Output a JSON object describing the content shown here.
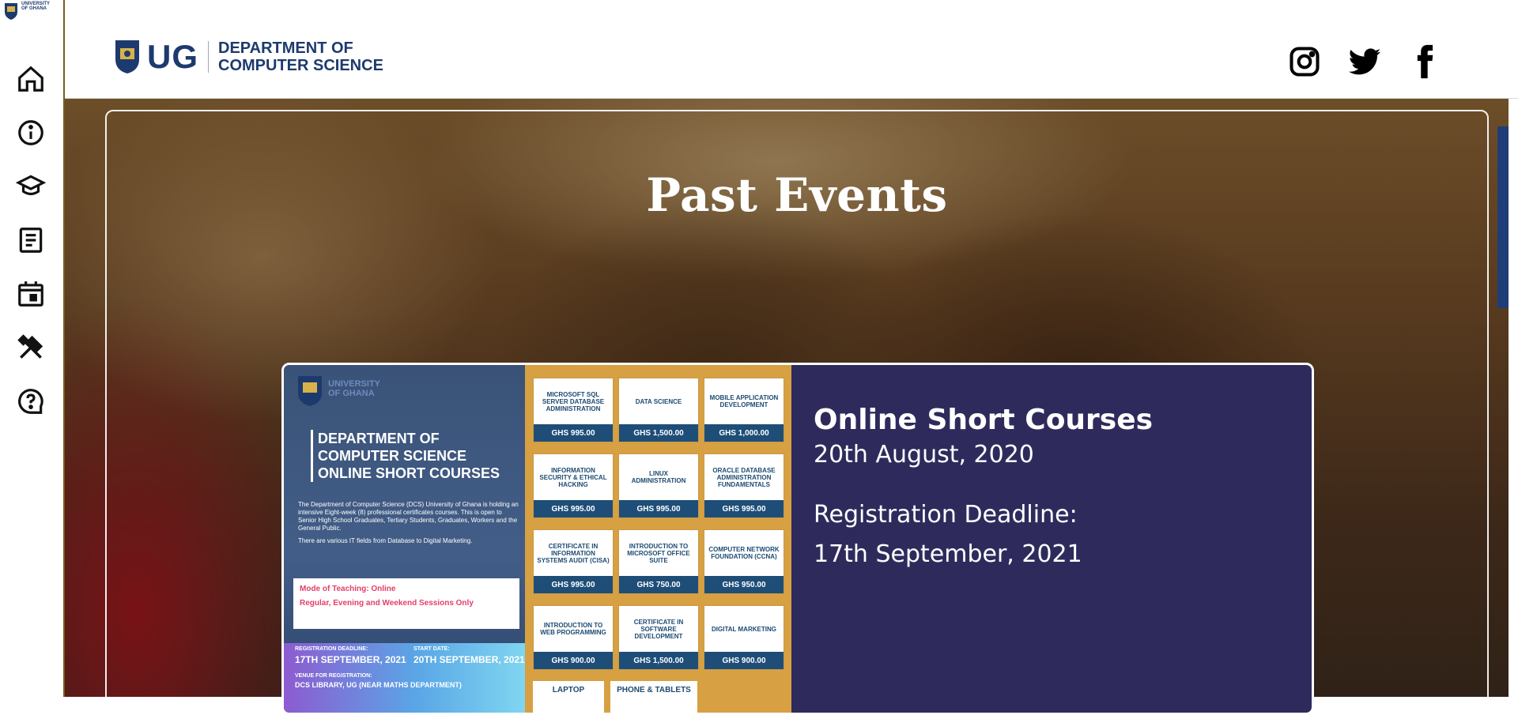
{
  "sidebar": {
    "logo_text": [
      "UNIVERSITY",
      "OF GHANA"
    ],
    "icons": [
      "home-icon",
      "info-icon",
      "graduation-cap-icon",
      "article-icon",
      "calendar-icon",
      "tools-icon",
      "help-icon"
    ]
  },
  "header": {
    "brand_abbr": "UG",
    "brand_line1": "DEPARTMENT OF",
    "brand_line2": "COMPUTER SCIENCE",
    "social": [
      "instagram-icon",
      "twitter-icon",
      "facebook-icon"
    ]
  },
  "hero": {
    "title": "Past Events"
  },
  "event": {
    "title": "Online Short Courses",
    "date": "20th August, 2020",
    "deadline_label": "Registration Deadline:",
    "deadline": "17th September, 2021",
    "flyer": {
      "uni_line1": "UNIVERSITY",
      "uni_line2": "OF GHANA",
      "heading1": "DEPARTMENT OF",
      "heading2": "COMPUTER SCIENCE",
      "heading3": "ONLINE SHORT COURSES",
      "intro1": "The Department of Computer Science (DCS) University of Ghana is holding an intensive Eight-week (8) professional certificates courses. This is open to Senior High School Graduates, Tertiary Students, Graduates, Workers and the General Public.",
      "intro2": "There are various IT fields from Database to Digital Marketing.",
      "mode": "Mode of Teaching: Online",
      "sessions": "Regular, Evening and Weekend Sessions Only",
      "reg_label": "REGISTRATION DEADLINE:",
      "reg_value": "17TH SEPTEMBER, 2021",
      "start_label": "START DATE:",
      "start_value": "20TH SEPTEMBER, 2021",
      "venue_label": "VENUE FOR REGISTRATION:",
      "venue_value": "DCS LIBRARY, UG (NEAR MATHS DEPARTMENT)",
      "courses": [
        {
          "name": "MICROSOFT SQL SERVER DATABASE ADMINISTRATION",
          "price": "GHS 995.00"
        },
        {
          "name": "DATA SCIENCE",
          "price": "GHS 1,500.00"
        },
        {
          "name": "MOBILE APPLICATION DEVELOPMENT",
          "price": "GHS 1,000.00"
        },
        {
          "name": "INFORMATION SECURITY & ETHICAL HACKING",
          "price": "GHS 995.00"
        },
        {
          "name": "LINUX ADMINISTRATION",
          "price": "GHS 995.00"
        },
        {
          "name": "ORACLE DATABASE ADMINISTRATION FUNDAMENTALS",
          "price": "GHS 995.00"
        },
        {
          "name": "CERTIFICATE IN INFORMATION SYSTEMS AUDIT (CISA)",
          "price": "GHS 995.00"
        },
        {
          "name": "INTRODUCTION TO MICROSOFT OFFICE SUITE",
          "price": "GHS 750.00"
        },
        {
          "name": "COMPUTER NETWORK FOUNDATION (CCNA)",
          "price": "GHS 950.00"
        },
        {
          "name": "INTRODUCTION TO WEB PROGRAMMING",
          "price": "GHS 900.00"
        },
        {
          "name": "CERTIFICATE IN SOFTWARE DEVELOPMENT",
          "price": "GHS 1,500.00"
        },
        {
          "name": "DIGITAL MARKETING",
          "price": "GHS 900.00"
        }
      ],
      "extra1": "LAPTOP",
      "extra2": "PHONE & TABLETS"
    }
  }
}
